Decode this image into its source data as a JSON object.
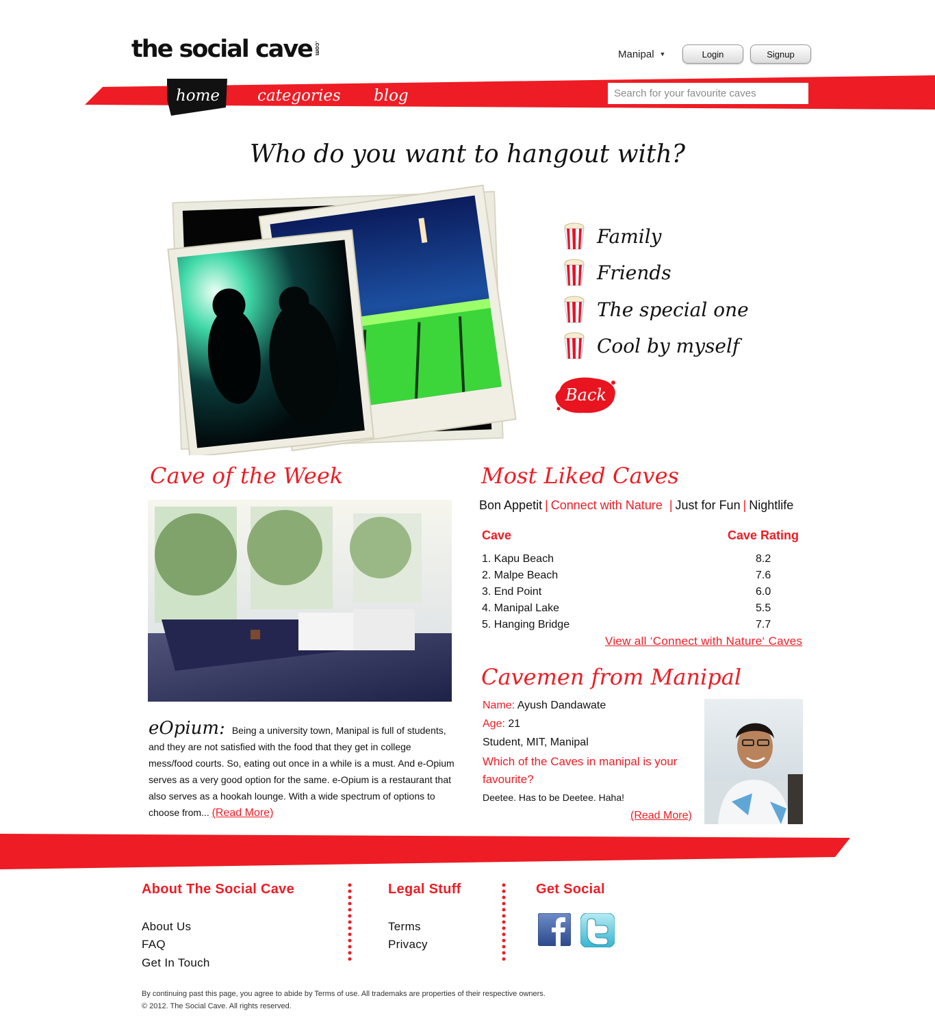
{
  "header": {
    "logo_text": "the social cave",
    "logo_suffix": ".com",
    "city": "Manipal",
    "login_label": "Login",
    "signup_label": "Signup"
  },
  "nav": {
    "items": [
      {
        "label": "home",
        "active": true
      },
      {
        "label": "categories",
        "active": false
      },
      {
        "label": "blog",
        "active": false
      }
    ],
    "search_placeholder": "Search for your favourite caves"
  },
  "hero": {
    "title": "Who do you want to hangout with?",
    "choices": [
      "Family",
      "Friends",
      "The special one",
      "Cool by myself"
    ],
    "back_label": "Back"
  },
  "cave_of_week": {
    "title": "Cave of the Week",
    "name": "eOpium:",
    "description": "Being a university town, Manipal is full of students, and they are not satisfied with the food that they get in college mess/food courts. So, eating out once in a while is a must. And e-Opium serves as a very good option for the same. e-Opium is a restaurant that also serves as a hookah lounge. With a wide spectrum of options to choose from...",
    "read_more": "(Read More)"
  },
  "most_liked": {
    "title": "Most Liked Caves",
    "tabs": [
      "Bon Appetit",
      "Connect with Nature",
      "Just for Fun",
      "Nightlife"
    ],
    "active_tab": "Connect with Nature",
    "col_cave": "Cave",
    "col_rating": "Cave Rating",
    "rows": [
      {
        "name": "1. Kapu Beach",
        "rating": "8.2"
      },
      {
        "name": "2. Malpe Beach",
        "rating": "7.6"
      },
      {
        "name": "3. End Point",
        "rating": "6.0"
      },
      {
        "name": "4. Manipal Lake",
        "rating": "5.5"
      },
      {
        "name": "5. Hanging Bridge",
        "rating": "7.7"
      }
    ],
    "view_all": "View all ‘Connect with Nature‘ Caves"
  },
  "cavemen": {
    "title": "Cavemen from Manipal",
    "name_label": "Name:",
    "name_value": "Ayush Dandawate",
    "age_label": "Age:",
    "age_value": "21",
    "school": "Student, MIT, Manipal",
    "question": "Which of the Caves in manipal is your favourite?",
    "answer": "Deetee. Has to be Deetee. Haha!",
    "read_more": "(Read More)"
  },
  "footer": {
    "about_title": "About The Social Cave",
    "about_links": [
      "About Us",
      "FAQ",
      "Get In Touch"
    ],
    "legal_title": "Legal Stuff",
    "legal_links": [
      "Terms",
      "Privacy"
    ],
    "social_title": "Get Social",
    "legal_line_1": "By continuing past this page, you agree to abide by Terms of use. All trademaks are properties of their respective owners.",
    "legal_line_2": "© 2012. The Social Cave. All rights reserved."
  },
  "colors": {
    "brand_red": "#ee1c24",
    "text": "#111111"
  },
  "icons": [
    "chevron-down-icon",
    "popcorn-icon",
    "facebook-icon",
    "twitter-icon"
  ]
}
